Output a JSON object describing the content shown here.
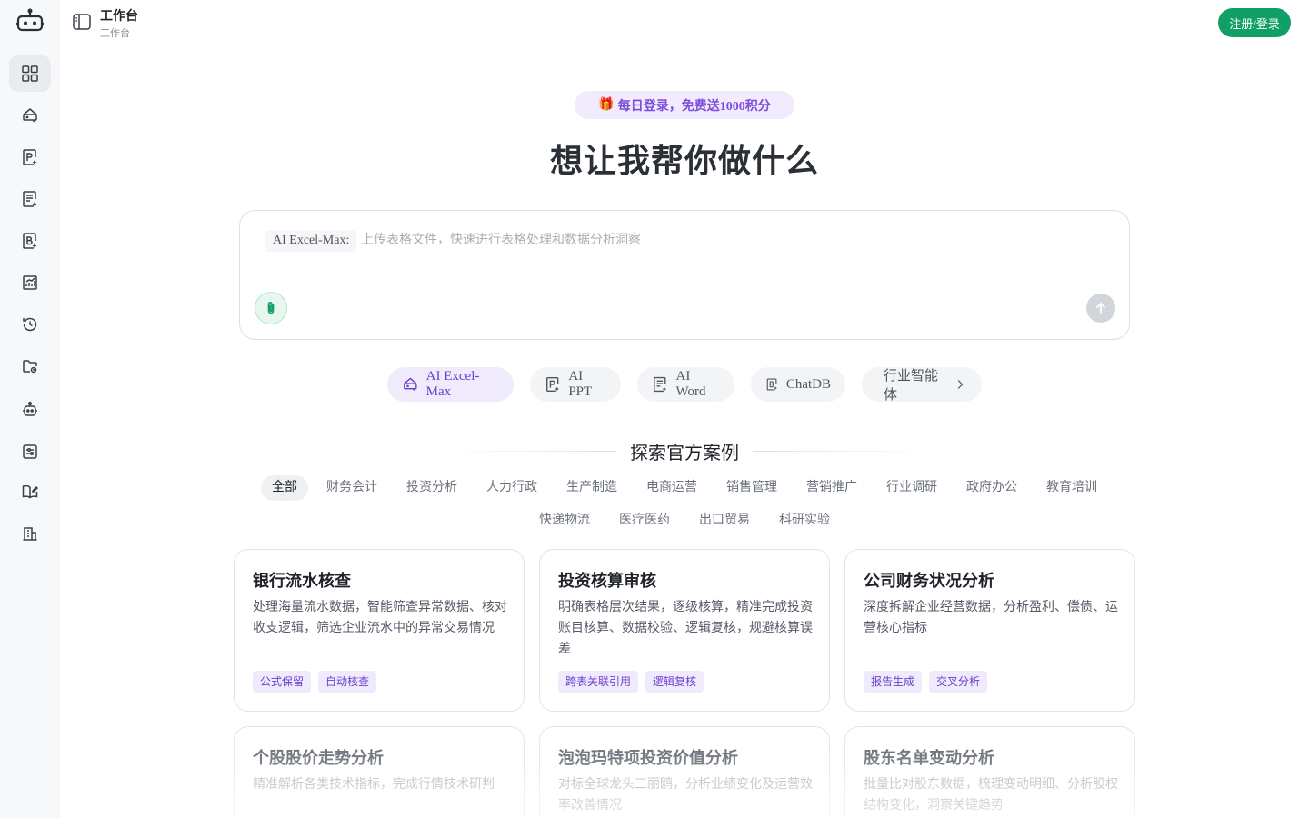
{
  "app": {
    "title": "工作台",
    "subtitle": "工作台"
  },
  "header": {
    "login_label": "注册/登录"
  },
  "promo": {
    "icon": "🎁",
    "text": "每日登录，免费送1000积分"
  },
  "headline": "想让我帮你做什么",
  "composer": {
    "mode_label": "AI Excel-Max:",
    "placeholder": "上传表格文件，快速进行表格处理和数据分析洞察"
  },
  "tools": [
    {
      "label": "AI Excel-Max",
      "icon": "excel-icon",
      "active": true
    },
    {
      "label": "AI PPT",
      "icon": "ppt-icon"
    },
    {
      "label": "AI Word",
      "icon": "word-icon"
    },
    {
      "label": "ChatDB",
      "icon": "database-icon"
    },
    {
      "label": "行业智能体",
      "icon": "chevron-right-icon"
    }
  ],
  "explore_title": "探索官方案例",
  "categories": [
    "全部",
    "财务会计",
    "投资分析",
    "人力行政",
    "生产制造",
    "电商运营",
    "销售管理",
    "营销推广",
    "行业调研",
    "政府办公",
    "教育培训",
    "快递物流",
    "医疗医药",
    "出口贸易",
    "科研实验"
  ],
  "cards": [
    {
      "title": "银行流水核查",
      "desc": "处理海量流水数据，智能筛查异常数据、核对收支逻辑，筛选企业流水中的异常交易情况",
      "tags": [
        "公式保留",
        "自动核查"
      ]
    },
    {
      "title": "投资核算审核",
      "desc": "明确表格层次结果，逐级核算，精准完成投资账目核算、数据校验、逻辑复核，规避核算误差",
      "tags": [
        "跨表关联引用",
        "逻辑复核"
      ]
    },
    {
      "title": "公司财务状况分析",
      "desc": "深度拆解企业经营数据，分析盈利、偿债、运营核心指标",
      "tags": [
        "报告生成",
        "交叉分析"
      ]
    },
    {
      "title": "个股股价走势分析",
      "desc": "精准解析各类技术指标，完成行情技术研判",
      "tags": []
    },
    {
      "title": "泡泡玛特项投资价值分析",
      "desc": "对标全球龙头三丽鸥，分析业绩变化及运营效率改善情况",
      "tags": []
    },
    {
      "title": "股东名单变动分析",
      "desc": "批量比对股东数据，梳理变动明细、分析股权结构变化，洞察关键趋势",
      "tags": []
    }
  ],
  "sidebar": {
    "items": [
      {
        "icon": "grid-icon",
        "active": true
      },
      {
        "icon": "excel-icon"
      },
      {
        "icon": "ppt-icon"
      },
      {
        "icon": "word-icon"
      },
      {
        "icon": "database-icon"
      },
      {
        "icon": "chart-icon"
      },
      {
        "icon": "history-icon"
      },
      {
        "icon": "folder-icon"
      },
      {
        "icon": "robot-icon"
      },
      {
        "icon": "settings-sliders-icon"
      },
      {
        "icon": "book-icon"
      },
      {
        "icon": "building-icon"
      }
    ]
  },
  "colors": {
    "accent": "#10a067",
    "purple": "#6a3fd0",
    "purple_bg": "#f0ebfc"
  }
}
